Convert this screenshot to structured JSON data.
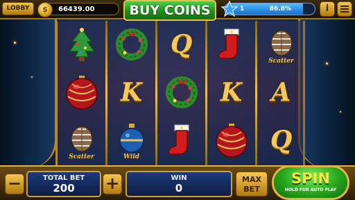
{
  "top_bar": {
    "lobby_label": "LOBBY",
    "coin_balance": "66439.00",
    "buy_coins_label": "BUY COINS",
    "level": "1",
    "level_progress_percent_text": "86.8%",
    "level_progress_fraction": 0.868,
    "info_icon": "info-icon",
    "menu_icon": "menu-icon"
  },
  "reels": [
    {
      "symbols": [
        {
          "id": "christmas-tree",
          "label": ""
        },
        {
          "id": "red-ornament",
          "label": ""
        },
        {
          "id": "pinecone",
          "label": "Scatter"
        }
      ]
    },
    {
      "symbols": [
        {
          "id": "wreath",
          "label": ""
        },
        {
          "id": "letter-k",
          "label": "K"
        },
        {
          "id": "blue-ornament",
          "label": "Wild"
        }
      ]
    },
    {
      "symbols": [
        {
          "id": "letter-q",
          "label": "Q"
        },
        {
          "id": "wreath",
          "label": ""
        },
        {
          "id": "stocking",
          "label": ""
        }
      ]
    },
    {
      "symbols": [
        {
          "id": "stocking",
          "label": ""
        },
        {
          "id": "letter-k",
          "label": "K"
        },
        {
          "id": "red-ornament",
          "label": ""
        }
      ]
    },
    {
      "symbols": [
        {
          "id": "pinecone",
          "label": "Scatter"
        },
        {
          "id": "letter-a",
          "label": "A"
        },
        {
          "id": "letter-q",
          "label": "Q"
        }
      ]
    }
  ],
  "bottom_bar": {
    "minus_label": "−",
    "plus_label": "+",
    "total_bet_label": "TOTAL BET",
    "total_bet_value": "200",
    "win_label": "WIN",
    "win_value": "0",
    "max_bet_line1": "MAX",
    "max_bet_line2": "BET",
    "spin_label": "SPIN",
    "spin_hint": "HOLD FOR AUTO PLAY"
  },
  "colors": {
    "gold": "#e0b545",
    "green_button": "#25a51b",
    "panel_blue": "#0d1c45",
    "progress_blue": "#1b6cc9"
  }
}
